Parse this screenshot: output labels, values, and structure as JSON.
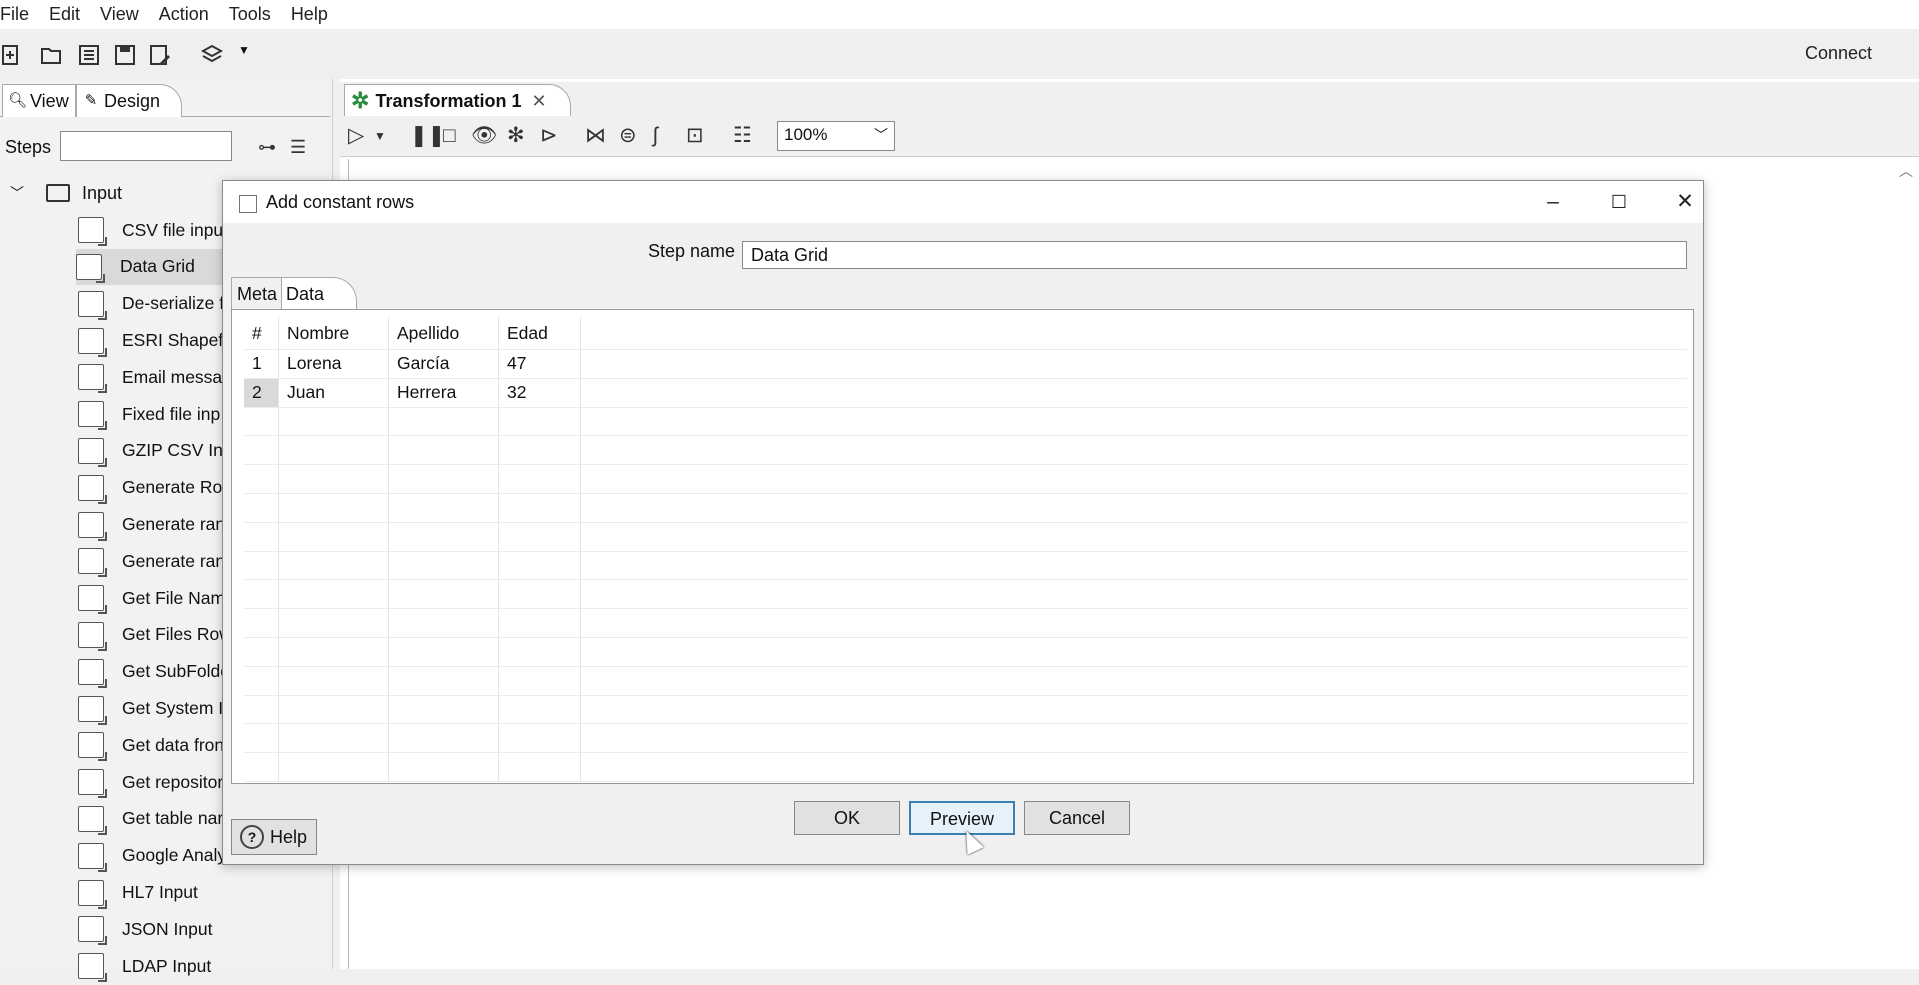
{
  "menu": [
    "File",
    "Edit",
    "View",
    "Action",
    "Tools",
    "Help"
  ],
  "toolbar": {
    "connect": "Connect"
  },
  "left_panel": {
    "tab_view": "View",
    "tab_design": "Design",
    "steps_label": "Steps",
    "folder": "Input",
    "items": [
      "CSV file inpu",
      "Data Grid",
      "De-serialize f",
      "ESRI Shapefil",
      "Email messag",
      "Fixed file inp",
      "GZIP CSV Inp",
      "Generate Rov",
      "Generate ran",
      "Generate ran",
      "Get File Nam",
      "Get Files Row",
      "Get SubFolde",
      "Get System I",
      "Get data fron",
      "Get repositor",
      "Get table nar",
      "Google Analy",
      "HL7 Input",
      "JSON Input",
      "LDAP Input"
    ],
    "selected_item": "Data Grid"
  },
  "canvas": {
    "tab_title": "Transformation 1",
    "zoom": "100%"
  },
  "dialog": {
    "title": "Add constant rows",
    "step_name_label": "Step name",
    "step_name_value": "Data Grid",
    "tab_meta": "Meta",
    "tab_data": "Data",
    "grid": {
      "columns": [
        "#",
        "Nombre",
        "Apellido",
        "Edad"
      ],
      "rows": [
        [
          "1",
          "Lorena",
          "García",
          "47"
        ],
        [
          "2",
          "Juan",
          "Herrera",
          "32"
        ]
      ]
    },
    "ok": "OK",
    "preview": "Preview",
    "cancel": "Cancel",
    "help": "Help"
  }
}
